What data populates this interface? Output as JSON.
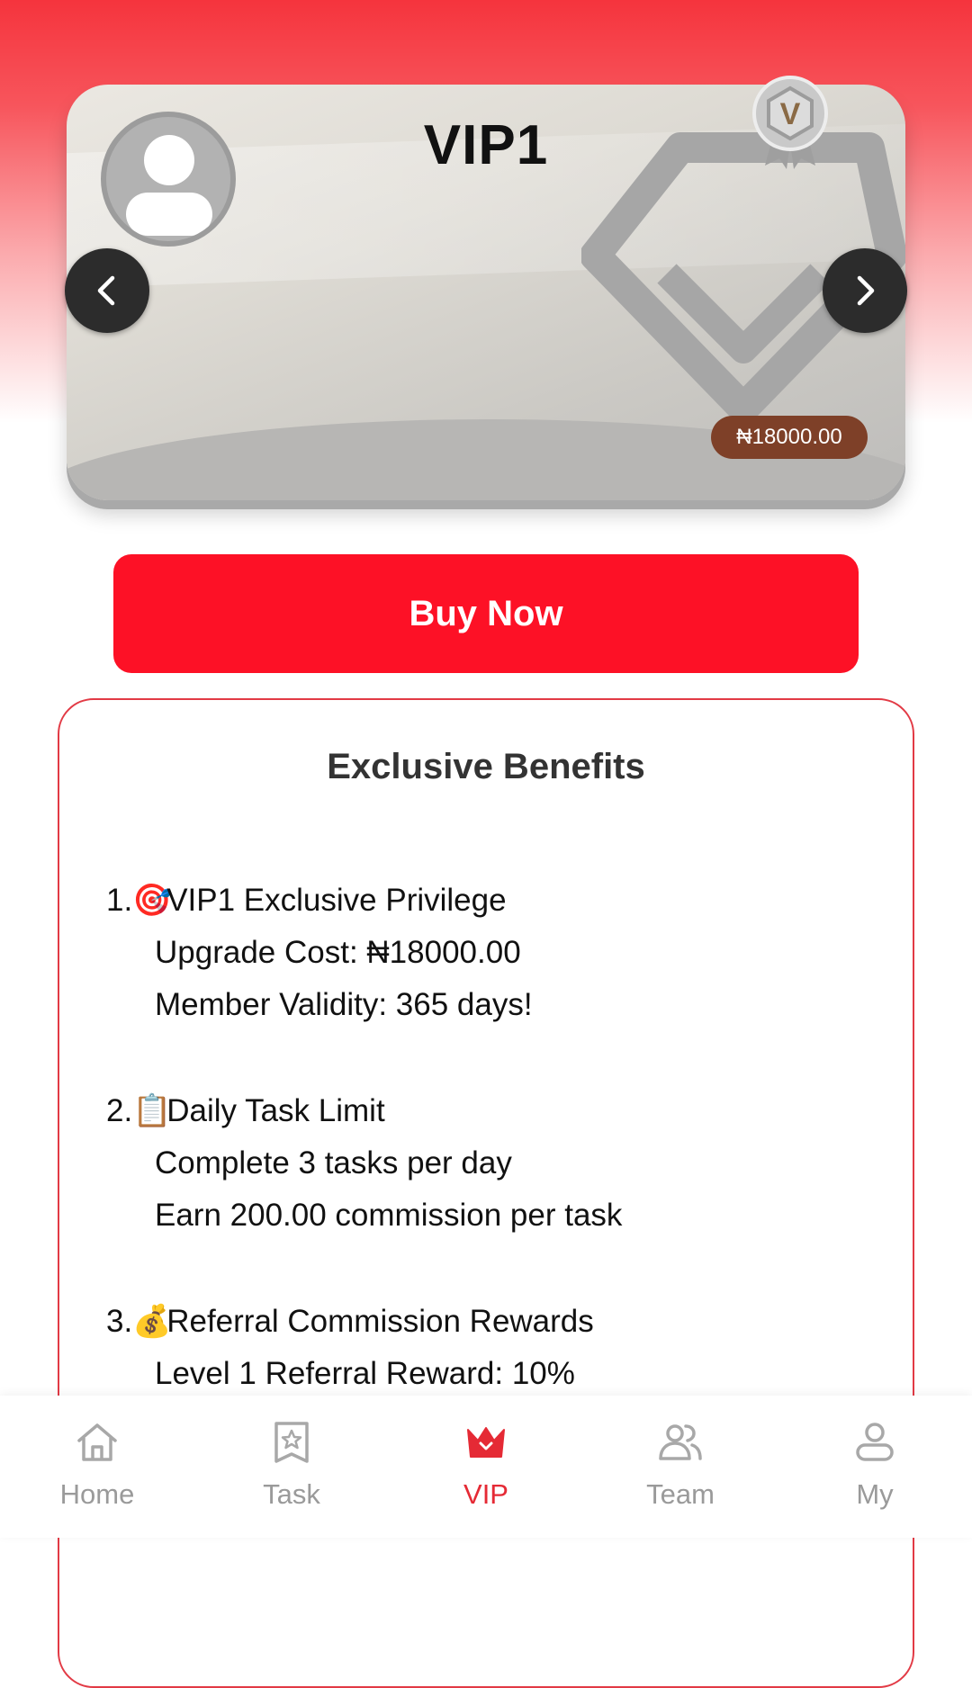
{
  "vip_card": {
    "title": "VIP1",
    "price": "₦18000.00",
    "badge_letter": "V"
  },
  "buy_button": {
    "label": "Buy Now"
  },
  "benefits": {
    "title": "Exclusive Benefits",
    "items": [
      {
        "number": "1.",
        "icon": "🎯",
        "heading": "VIP1 Exclusive Privilege",
        "lines": [
          "Upgrade Cost: ₦18000.00",
          "Member Validity: 365 days!"
        ]
      },
      {
        "number": "2.",
        "icon": "📋",
        "heading": "Daily Task Limit",
        "lines": [
          "Complete 3 tasks per day",
          "Earn 200.00 commission per task"
        ]
      },
      {
        "number": "3.",
        "icon": "💰",
        "heading": "Referral Commission Rewards",
        "lines": [
          "Level 1 Referral Reward: 10%"
        ]
      }
    ]
  },
  "bottom_nav": {
    "items": [
      {
        "label": "Home",
        "icon": "home-icon"
      },
      {
        "label": "Task",
        "icon": "task-star-icon"
      },
      {
        "label": "VIP",
        "icon": "crown-icon",
        "active": true
      },
      {
        "label": "Team",
        "icon": "team-icon"
      },
      {
        "label": "My",
        "icon": "user-icon"
      }
    ]
  },
  "colors": {
    "primary_red": "#fd1126",
    "active_nav": "#e52a35",
    "inactive_nav": "#9a9a9a",
    "price_tag_bg": "#7e4028"
  }
}
